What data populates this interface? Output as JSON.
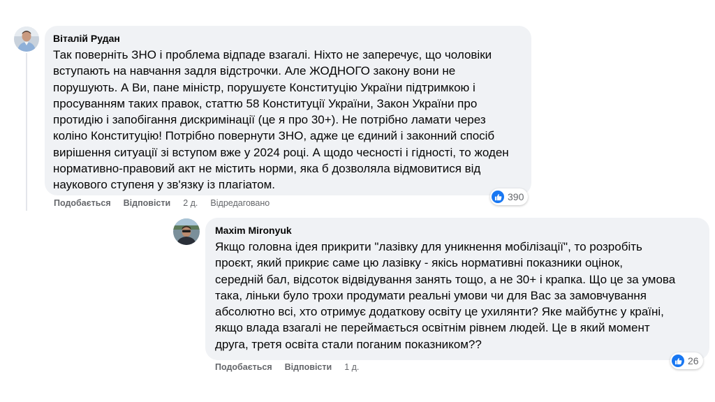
{
  "colors": {
    "bubble": "#f0f2f5",
    "like_blue": "#1877f2",
    "secondary_text": "#65676b"
  },
  "comments": [
    {
      "author": "Віталій Рудан",
      "text": "Так поверніть ЗНО і проблема відпаде взагалі. Ніхто не заперечує, що чоловіки\nвступають на навчання задля відстрочки. Але ЖОДНОГО закону вони не\nпорушують. А Ви, пане міністр, порушуєте Конституцію України підтримкою і\nпросуванням таких правок, статтю 58 Конституції України, Закон України про\nпротидію і запобігання дискримінації (це я про 30+). Не потрібно ламати через\nколіно Конституцію! Потрібно повернути ЗНО, адже це єдиний і законний спосіб\nвирішення ситуації зі вступом вже у 2024 році. А щодо чесності і гідності, то жоден\nнормативно-правовий акт не містить норми, яка б дозволяла відмовитися від\nнаукового ступеня у зв'язку із плагіатом.",
      "reaction_icon": "like-icon",
      "reaction_count": "390",
      "like_label": "Подобається",
      "reply_label": "Відповісти",
      "time": "2 д.",
      "edited": "Відредаговано"
    },
    {
      "author": "Maxim Mironyuk",
      "text": "Якщо головна ідея прикрити \"лазівку для уникнення мобілізації\", то розробіть\nпроєкт, який прикриє саме цю лазівку - якісь нормативні показники оцінок,\nсередній бал, відсоток відвідування занять тощо, а не 30+ і крапка. Що це за умова\nтака, ліньки було трохи продумати реальні умови чи для Вас за замовчування\nабсолютно всі, хто отримує додаткову освіту це ухилянти? Яке майбутнє у країні,\nякщо влада взагалі не переймається освітнім рівнем людей. Це в який момент\nдруга, третя освіта стали поганим показником??",
      "reaction_icon": "like-icon",
      "reaction_count": "26",
      "like_label": "Подобається",
      "reply_label": "Відповісти",
      "time": "1 д."
    }
  ]
}
